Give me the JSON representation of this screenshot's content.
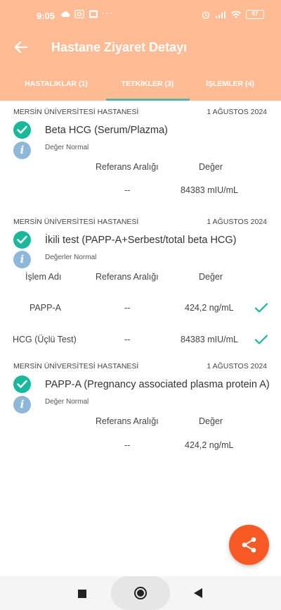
{
  "status_bar": {
    "time": "9:05",
    "dots": "···",
    "battery": "97"
  },
  "header": {
    "title": "Hastane Ziyaret Detayı"
  },
  "tabs": [
    {
      "label": "HASTALIKLAR (1)"
    },
    {
      "label": "TETKİKLER (3)",
      "active": true
    },
    {
      "label": "İŞLEMLER (4)"
    }
  ],
  "results": [
    {
      "hospital": "MERSİN ÜNİVERSİTESİ HASTANESİ",
      "date": "1 AĞUSTOS 2024",
      "test_name": "Beta HCG (Serum/Plazma)",
      "status": "Değer Normal",
      "columns": {
        "range": "Referans Aralığı",
        "value": "Değer"
      },
      "rows": [
        {
          "range": "--",
          "value": "84383 mIU/mL"
        }
      ]
    },
    {
      "hospital": "MERSİN ÜNİVERSİTESİ HASTANESİ",
      "date": "1 AĞUSTOS 2024",
      "test_name": "İkili test (PAPP-A+Serbest/total beta HCG)",
      "status": "Değerler Normal",
      "columns": {
        "name": "İşlem Adı",
        "range": "Referans Aralığı",
        "value": "Değer"
      },
      "rows": [
        {
          "name": "PAPP-A",
          "range": "--",
          "value": "424,2 ng/mL"
        },
        {
          "name": "HCG (Üçlü Test)",
          "range": "--",
          "value": "84383 mIU/mL"
        }
      ]
    },
    {
      "hospital": "MERSİN ÜNİVERSİTESİ HASTANESİ",
      "date": "1 AĞUSTOS 2024",
      "test_name": "PAPP-A (Pregnancy associated plasma protein A)",
      "status": "Değer Normal",
      "columns": {
        "range": "Referans Aralığı",
        "value": "Değer"
      },
      "rows": [
        {
          "range": "--",
          "value": "424,2 ng/mL"
        }
      ]
    }
  ],
  "colors": {
    "header": "#ffbc94",
    "tab_indicator": "#4db7b3",
    "check": "#18b99a",
    "info": "#8eb7da",
    "fab": "#f85a25"
  },
  "icons": {
    "back": "arrow-left-icon",
    "check": "check-circle-icon",
    "info": "info-icon",
    "share": "share-icon"
  }
}
